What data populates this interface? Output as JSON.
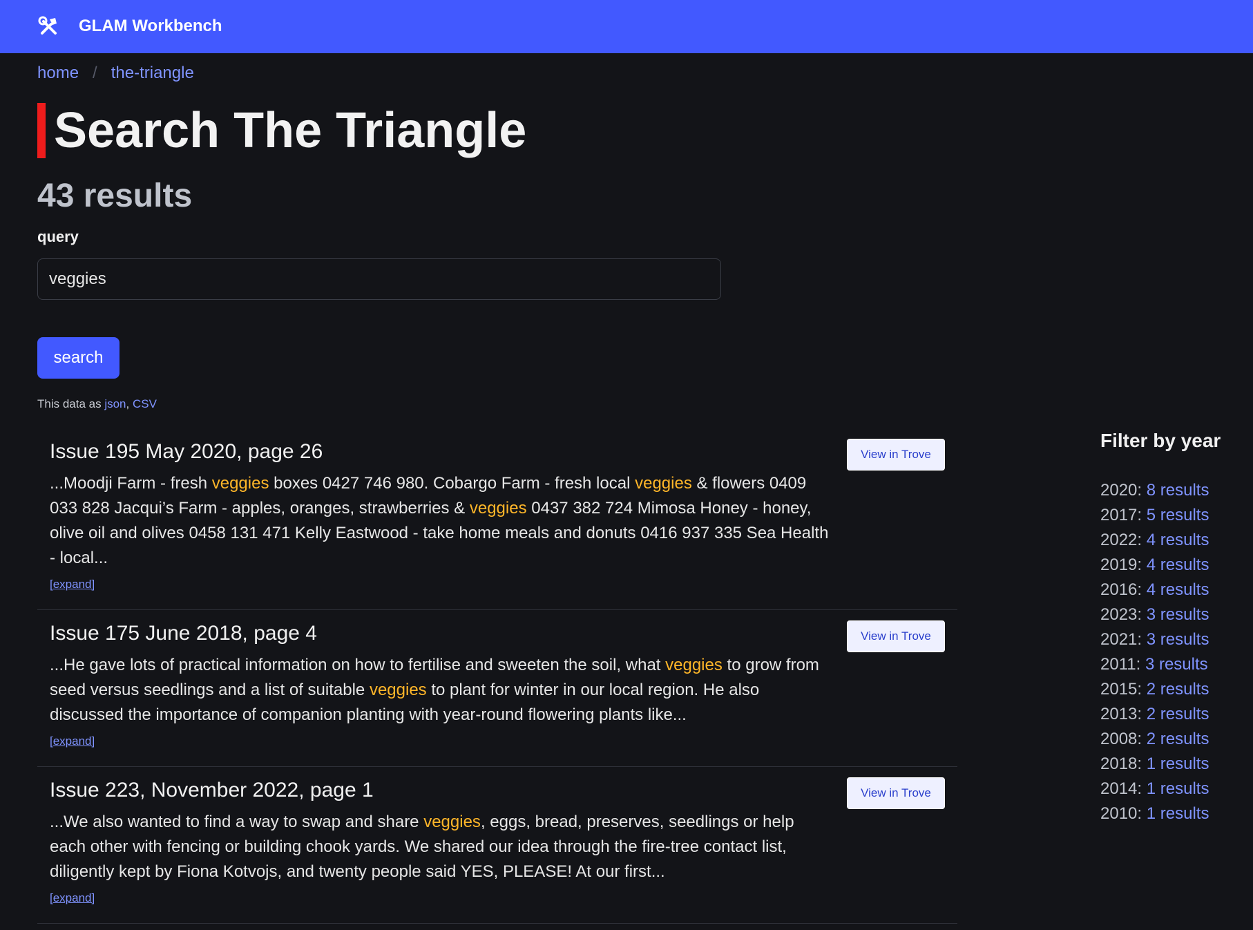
{
  "header": {
    "title": "GLAM Workbench",
    "icon": "tools-icon",
    "color": "#4259ff"
  },
  "breadcrumb": {
    "home": "home",
    "separator": "/",
    "current": "the-triangle"
  },
  "page": {
    "title": "Search The Triangle",
    "result_count": "43 results",
    "accent_color": "#ee1c1c"
  },
  "search": {
    "label": "query",
    "value": "veggies",
    "button_label": "search"
  },
  "export": {
    "prefix": "This data as ",
    "json_label": "json",
    "comma": ",",
    "csv_label": "CSV"
  },
  "results": [
    {
      "title": "Issue 195 May 2020, page 26",
      "snippet": [
        {
          "text": "...Moodji Farm - fresh ",
          "hl": false
        },
        {
          "text": "veggies",
          "hl": true
        },
        {
          "text": " boxes 0427 746 980. Cobargo Farm - fresh local ",
          "hl": false
        },
        {
          "text": "veggies",
          "hl": true
        },
        {
          "text": " & flowers 0409 033 828 Jacqui’s Farm - apples, oranges, strawberries & ",
          "hl": false
        },
        {
          "text": "veggies",
          "hl": true
        },
        {
          "text": " 0437 382 724 Mimosa Honey - honey, olive oil and olives 0458 131 471 Kelly Eastwood - take home meals and donuts 0416 937 335 Sea Health - local...",
          "hl": false
        }
      ],
      "expand_label": "[expand]",
      "button_label": "View in Trove"
    },
    {
      "title": "Issue 175 June 2018, page 4",
      "snippet": [
        {
          "text": "...He gave lots of practical information on how to fertilise and sweeten the soil, what ",
          "hl": false
        },
        {
          "text": "veggies",
          "hl": true
        },
        {
          "text": " to grow from seed versus seedlings and a list of suitable ",
          "hl": false
        },
        {
          "text": "veggies",
          "hl": true
        },
        {
          "text": " to plant for winter in our local region. He also discussed the importance of companion planting with year-round flowering plants like...",
          "hl": false
        }
      ],
      "expand_label": "[expand]",
      "button_label": "View in Trove"
    },
    {
      "title": "Issue 223, November 2022, page 1",
      "snippet": [
        {
          "text": "...We also wanted to find a way to swap and share ",
          "hl": false
        },
        {
          "text": "veggies",
          "hl": true
        },
        {
          "text": ", eggs, bread, preserves, seedlings or help each other with fencing or building chook yards. We shared our idea through the fire-tree contact list, diligently kept by Fiona Kotvojs, and twenty people said YES, PLEASE! At our first...",
          "hl": false
        }
      ],
      "expand_label": "[expand]",
      "button_label": "View in Trove"
    }
  ],
  "filter": {
    "title": "Filter by year",
    "items": [
      {
        "year": "2020:",
        "count": "8 results"
      },
      {
        "year": "2017:",
        "count": "5 results"
      },
      {
        "year": "2022:",
        "count": "4 results"
      },
      {
        "year": "2019:",
        "count": "4 results"
      },
      {
        "year": "2016:",
        "count": "4 results"
      },
      {
        "year": "2023:",
        "count": "3 results"
      },
      {
        "year": "2021:",
        "count": "3 results"
      },
      {
        "year": "2011:",
        "count": "3 results"
      },
      {
        "year": "2015:",
        "count": "2 results"
      },
      {
        "year": "2013:",
        "count": "2 results"
      },
      {
        "year": "2008:",
        "count": "2 results"
      },
      {
        "year": "2018:",
        "count": "1 results"
      },
      {
        "year": "2014:",
        "count": "1 results"
      },
      {
        "year": "2010:",
        "count": "1 results"
      }
    ]
  }
}
